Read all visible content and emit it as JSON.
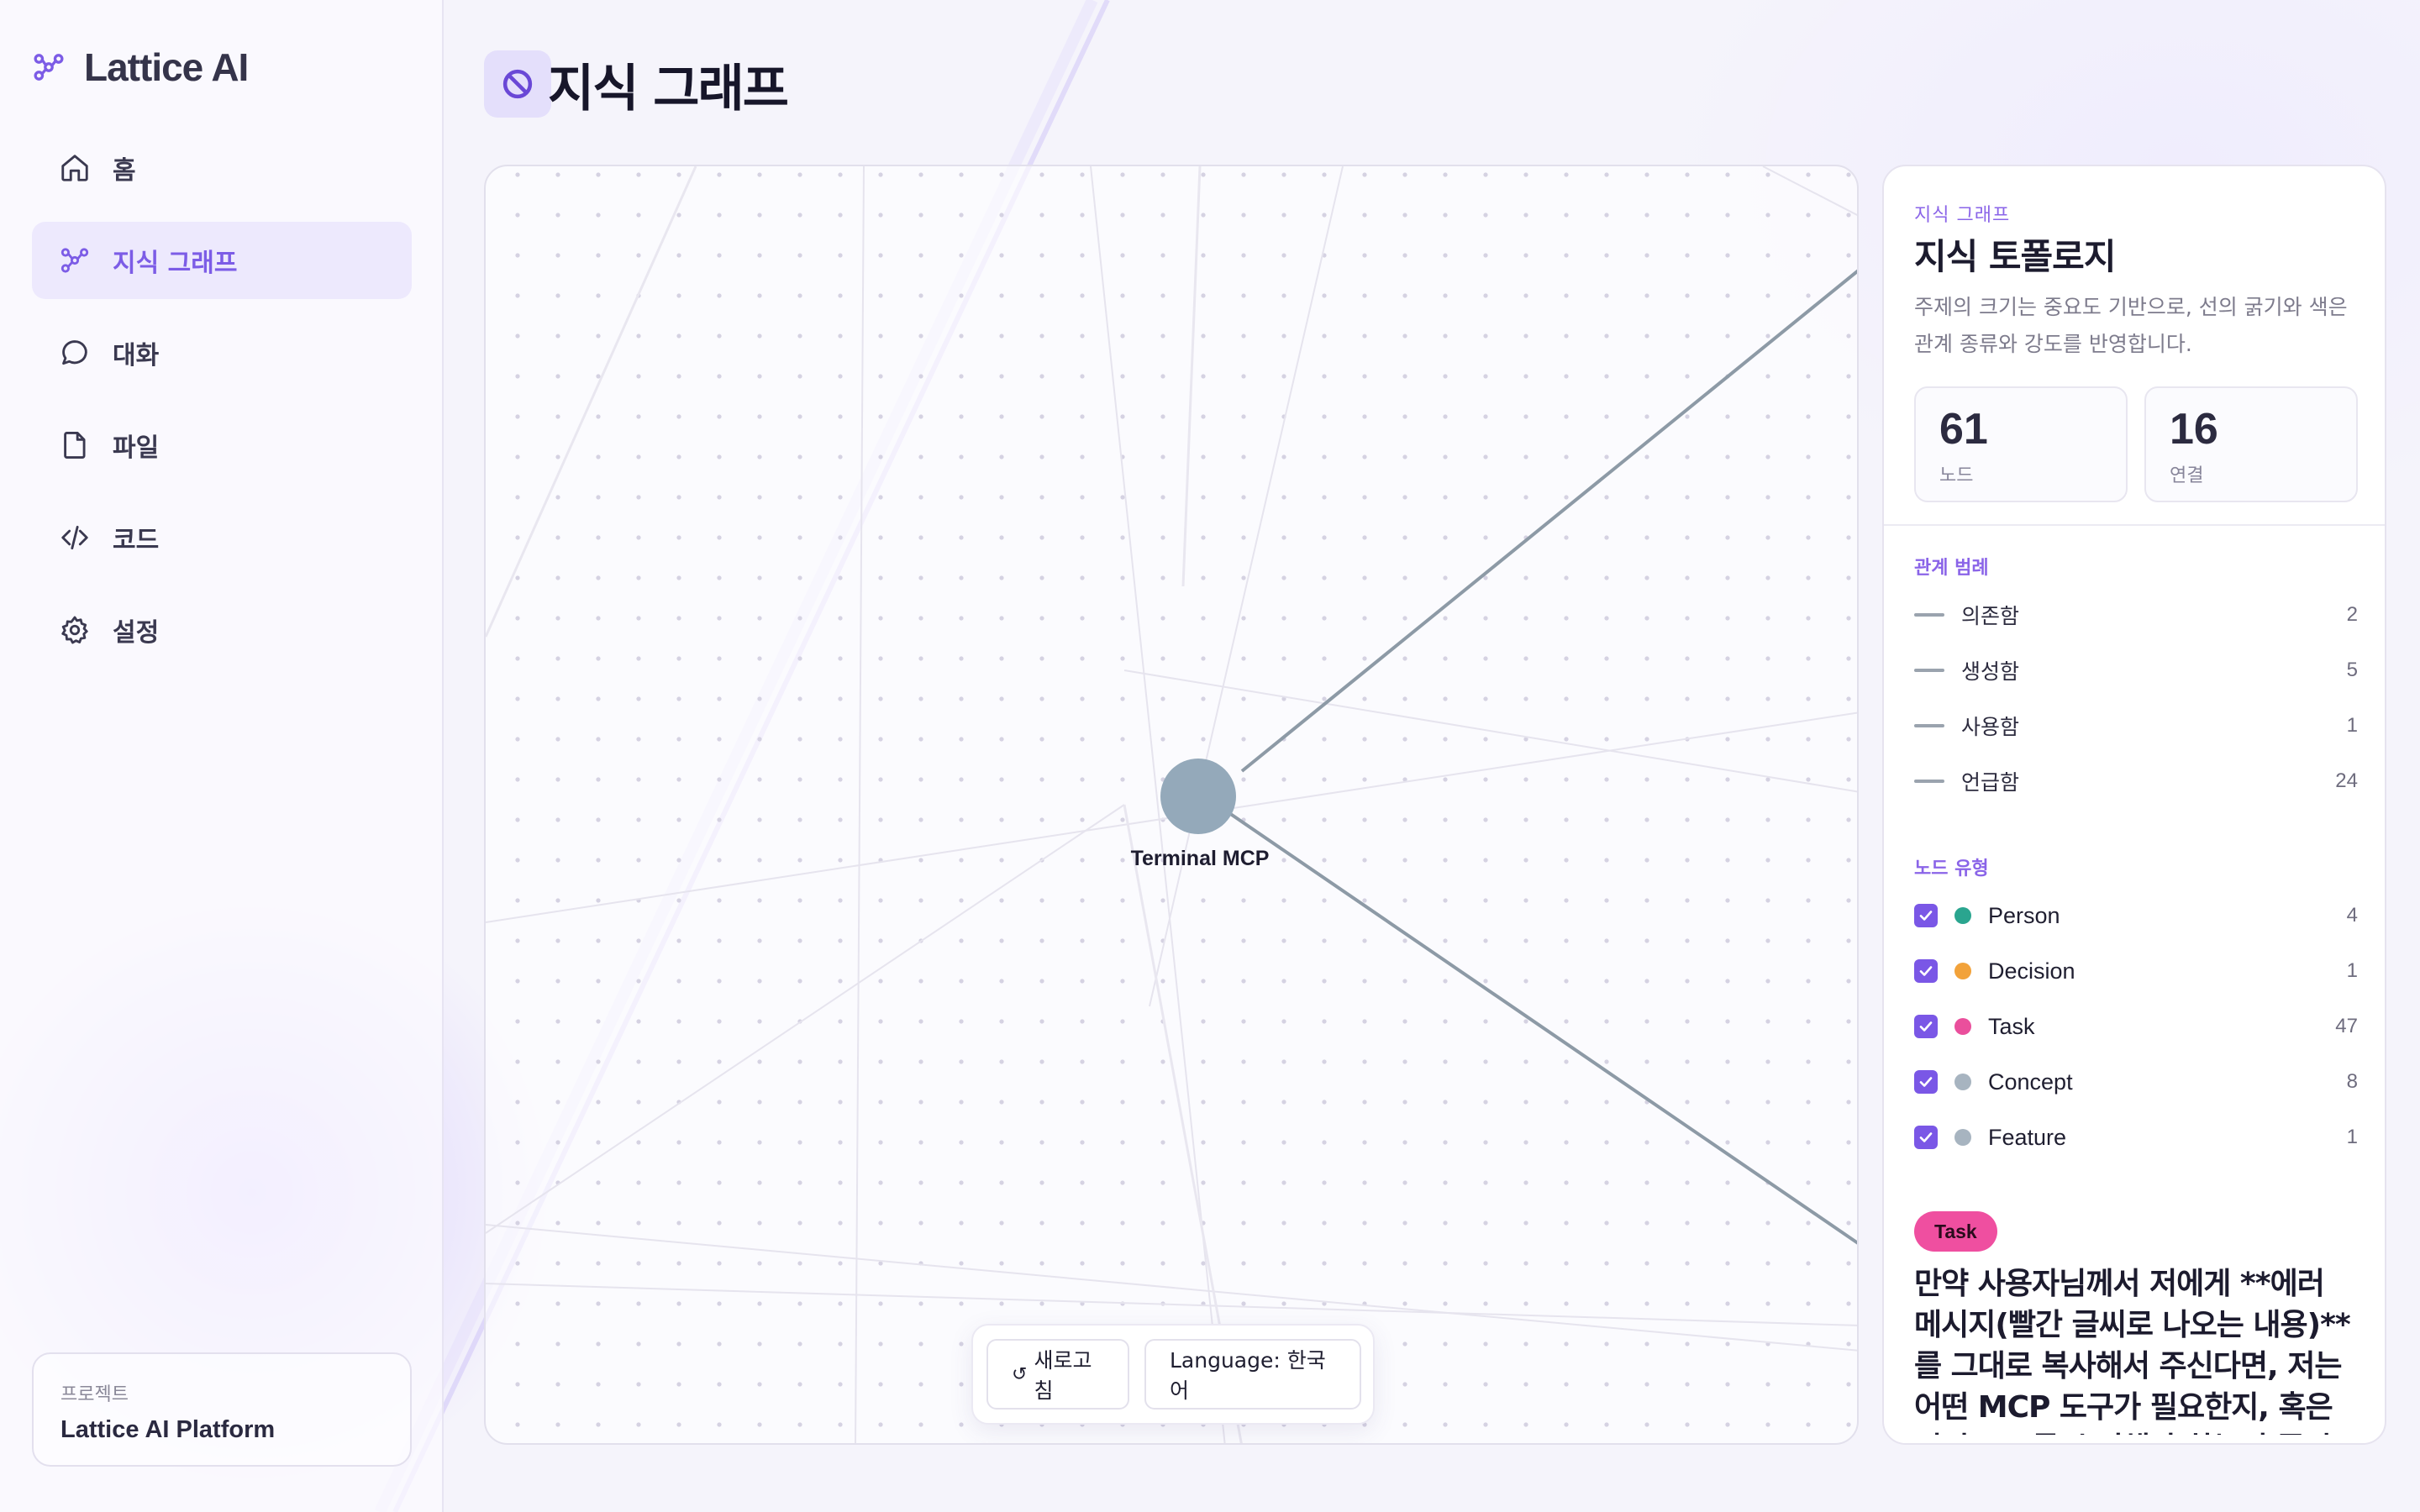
{
  "app": {
    "name": "Lattice AI"
  },
  "sidebar": {
    "items": [
      {
        "label": "홈",
        "icon": "home-icon",
        "active": false
      },
      {
        "label": "지식 그래프",
        "icon": "graph-icon",
        "active": true
      },
      {
        "label": "대화",
        "icon": "chat-icon",
        "active": false
      },
      {
        "label": "파일",
        "icon": "file-icon",
        "active": false
      },
      {
        "label": "코드",
        "icon": "code-icon",
        "active": false
      },
      {
        "label": "설정",
        "icon": "gear-icon",
        "active": false
      }
    ],
    "project": {
      "label": "프로젝트",
      "name": "Lattice AI Platform"
    }
  },
  "page": {
    "title": "지식 그래프",
    "title_icon": "blocked-icon"
  },
  "graph": {
    "center_node": {
      "label": "Terminal MCP",
      "color": "#94a9ba"
    },
    "edge_color": "#8d9aa6"
  },
  "toolbar": {
    "refresh_label": "새로고침",
    "refresh_icon": "↺",
    "language_label": "Language: 한국어"
  },
  "panel": {
    "eyebrow": "지식 그래프",
    "title": "지식 토폴로지",
    "description": "주제의 크기는 중요도 기반으로, 선의 굵기와 색은 관계 종류와 강도를 반영합니다.",
    "stats": [
      {
        "value": "61",
        "label": "노드"
      },
      {
        "value": "16",
        "label": "연결"
      }
    ],
    "legend_title": "관계 범례",
    "relations": [
      {
        "label": "의존함",
        "count": "2"
      },
      {
        "label": "생성함",
        "count": "5"
      },
      {
        "label": "사용함",
        "count": "1"
      },
      {
        "label": "언급함",
        "count": "24"
      }
    ],
    "types_title": "노드 유형",
    "node_types": [
      {
        "label": "Person",
        "count": "4",
        "color": "#2aa58f",
        "checked": true
      },
      {
        "label": "Decision",
        "count": "1",
        "color": "#f2a23a",
        "checked": true
      },
      {
        "label": "Task",
        "count": "47",
        "color": "#ea4f9c",
        "checked": true
      },
      {
        "label": "Concept",
        "count": "8",
        "color": "#a7b4c0",
        "checked": true
      },
      {
        "label": "Feature",
        "count": "1",
        "color": "#a7b4c0",
        "checked": true
      }
    ],
    "selected": {
      "badge": "Task",
      "text": "만약 사용자님께서 저에게 **에러 메시지(빨간 글씨로 나오는 내용)**를 그대로 복사해서 주신다면, 저는 어떤 MCP 도구가 필요한지, 혹은 어떤 코드를 수정해야 하는지 즉시"
    }
  },
  "colors": {
    "accent": "#7c5ce6",
    "active_bg": "#ede9fd"
  }
}
